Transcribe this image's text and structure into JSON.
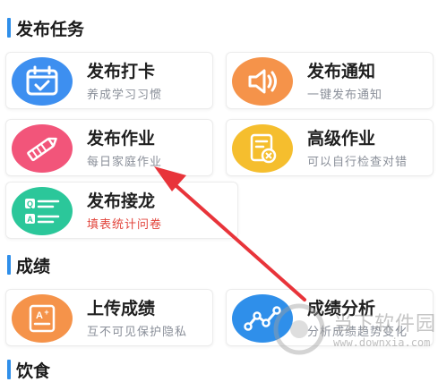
{
  "sections": {
    "publish": {
      "title": "发布任务"
    },
    "scores": {
      "title": "成绩"
    },
    "next": {
      "title": "饮食"
    }
  },
  "cards": {
    "checkin": {
      "title": "发布打卡",
      "subtitle": "养成学习习惯",
      "icon": "calendar-check-icon",
      "color": "#3d8ff0"
    },
    "notice": {
      "title": "发布通知",
      "subtitle": "一键发布通知",
      "icon": "speaker-icon",
      "color": "#f5934a"
    },
    "homework": {
      "title": "发布作业",
      "subtitle": "每日家庭作业",
      "icon": "pencil-icon",
      "color": "#f2557a"
    },
    "advanced": {
      "title": "高级作业",
      "subtitle": "可以自行检查对错",
      "icon": "document-check-icon",
      "color": "#f5be2e"
    },
    "relay": {
      "title": "发布接龙",
      "subtitle": "填表统计问卷",
      "icon": "qa-list-icon",
      "color": "#2bc79a"
    },
    "upload_scores": {
      "title": "上传成绩",
      "subtitle": "互不可见保护隐私",
      "icon": "grade-sheet-icon",
      "color": "#f5934a"
    },
    "analysis": {
      "title": "成绩分析",
      "subtitle": "分析成绩趋势变化",
      "icon": "trend-line-icon",
      "color": "#2f8fea"
    }
  },
  "watermark": {
    "text1": "当下软件园",
    "text2": "www.downxia.com"
  },
  "colors": {
    "accent": "#2f8fea",
    "arrow": "#e8343a"
  }
}
